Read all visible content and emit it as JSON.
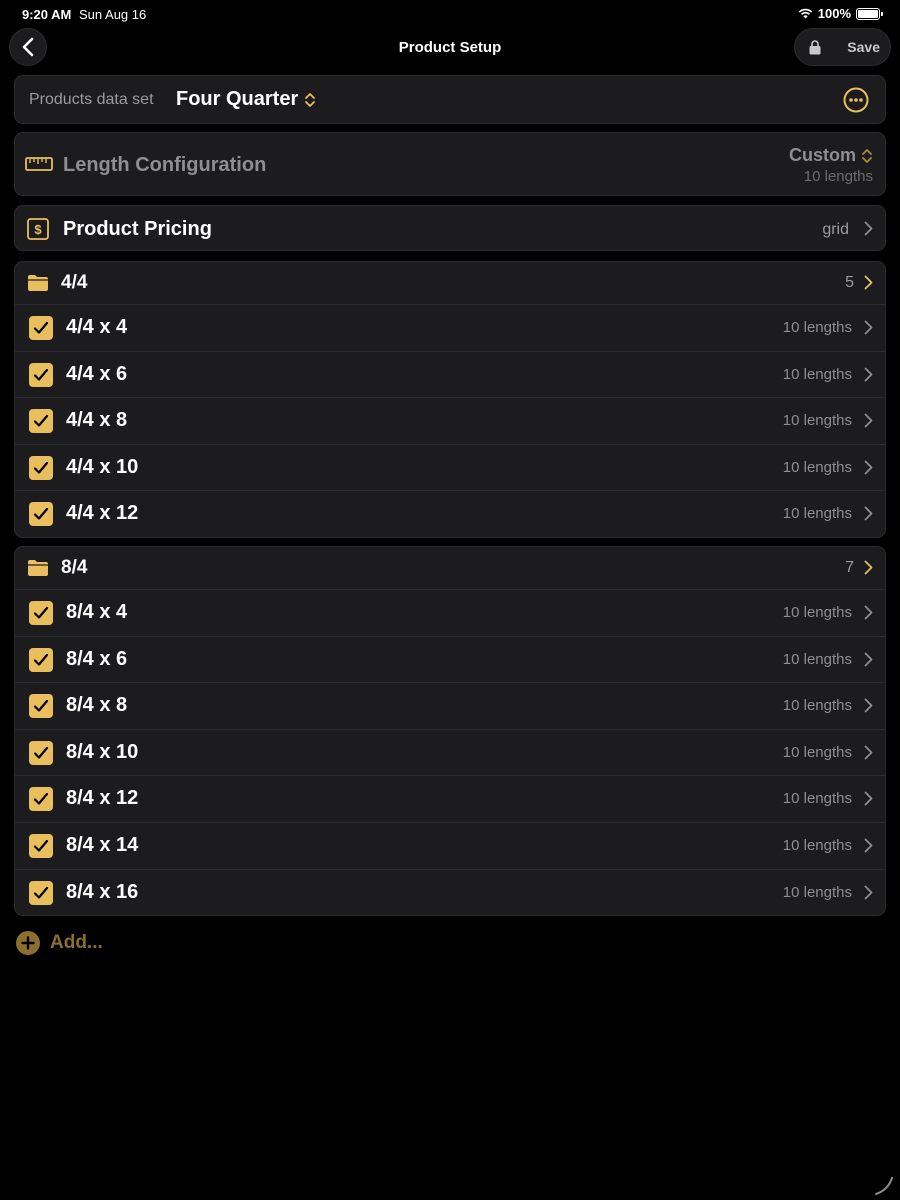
{
  "status": {
    "time": "9:20 AM",
    "date": "Sun Aug 16",
    "battery": "100%"
  },
  "nav": {
    "title": "Product Setup",
    "save_label": "Save"
  },
  "dataset": {
    "label": "Products data set",
    "value": "Four Quarter"
  },
  "length_config": {
    "label": "Length Configuration",
    "value": "Custom",
    "sub": "10 lengths"
  },
  "pricing": {
    "label": "Product Pricing",
    "value": "grid"
  },
  "groups": [
    {
      "title": "4/4",
      "count": "5",
      "items": [
        {
          "label": "4/4 x 4",
          "detail": "10 lengths"
        },
        {
          "label": "4/4 x 6",
          "detail": "10 lengths"
        },
        {
          "label": "4/4 x 8",
          "detail": "10 lengths"
        },
        {
          "label": "4/4 x 10",
          "detail": "10 lengths"
        },
        {
          "label": "4/4 x 12",
          "detail": "10 lengths"
        }
      ]
    },
    {
      "title": "8/4",
      "count": "7",
      "items": [
        {
          "label": "8/4 x 4",
          "detail": "10 lengths"
        },
        {
          "label": "8/4 x 6",
          "detail": "10 lengths"
        },
        {
          "label": "8/4 x 8",
          "detail": "10 lengths"
        },
        {
          "label": "8/4 x 10",
          "detail": "10 lengths"
        },
        {
          "label": "8/4 x 12",
          "detail": "10 lengths"
        },
        {
          "label": "8/4 x 14",
          "detail": "10 lengths"
        },
        {
          "label": "8/4 x 16",
          "detail": "10 lengths"
        }
      ]
    }
  ],
  "add": {
    "label": "Add..."
  },
  "colors": {
    "accent": "#e8be5e",
    "card": "#1c1c1e",
    "background": "#000000"
  },
  "icons": [
    "wifi-icon",
    "battery-icon",
    "back-icon",
    "lock-icon",
    "updown-chevron-icon",
    "more-icon",
    "ruler-icon",
    "dollar-icon",
    "folder-icon",
    "checkmark-icon",
    "chevron-right-icon",
    "plus-circle-icon"
  ]
}
